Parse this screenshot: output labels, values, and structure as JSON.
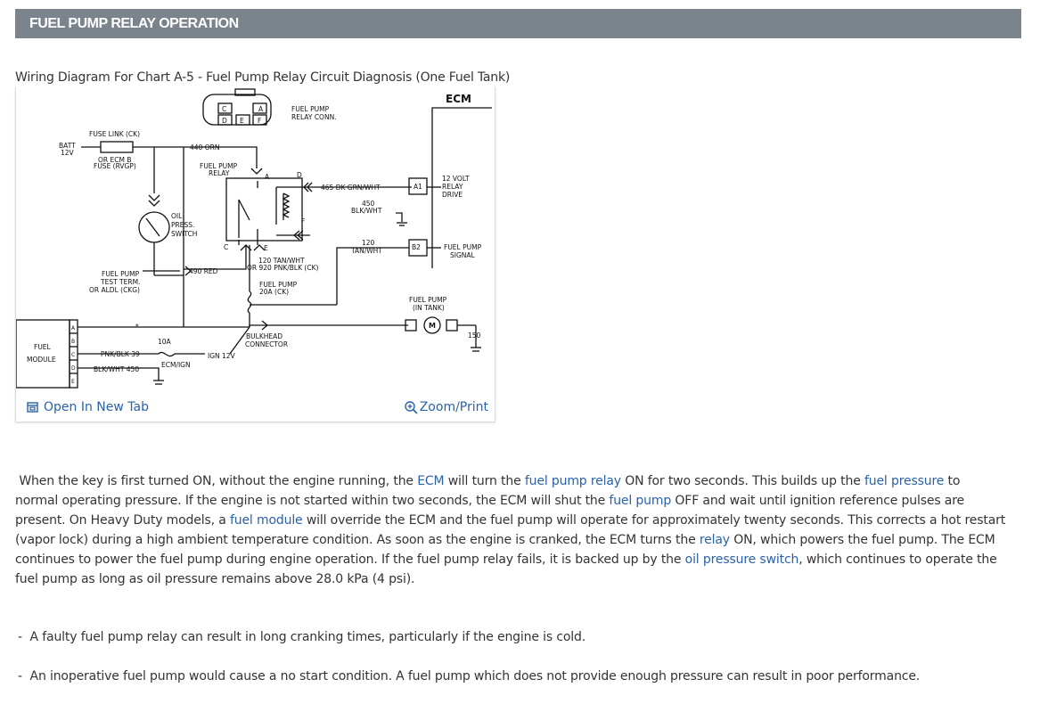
{
  "header": {
    "title": "FUEL PUMP RELAY OPERATION"
  },
  "figure": {
    "caption": "Wiring Diagram For Chart A-5 - Fuel Pump Relay Circuit Diagnosis (One Fuel Tank)",
    "labels": {
      "ecm": "ECM",
      "conn_c": "C",
      "conn_a": "A",
      "conn_d": "D",
      "conn_e": "E",
      "conn_f": "F",
      "relay_conn_1": "FUEL PUMP",
      "relay_conn_2": "RELAY CONN.",
      "fuse_link": "FUSE LINK (CK)",
      "batt": "BATT",
      "batt_v": "12V",
      "or_ecm_b": "OR ECM B",
      "fuse_rvgp": "FUSE (RVGP)",
      "orn_440": "440 ORN",
      "relay_1": "FUEL PUMP",
      "relay_2": "RELAY",
      "pin_a": "A",
      "pin_d": "D",
      "pin_f": "F",
      "pin_c": "C",
      "pin_e": "E",
      "grn_wht": "465 DK GRN/WHT",
      "pin_a1": "A1",
      "drive_1": "12 VOLT",
      "drive_2": "RELAY",
      "drive_3": "DRIVE",
      "blk_450": "450",
      "blk_wht": "BLK/WHT",
      "oil_1": "OIL",
      "oil_2": "PRESS.",
      "oil_3": "SWITCH",
      "tan_120": "120",
      "tan_wht": "TAN/WHT",
      "pin_b2": "B2",
      "signal_1": "FUEL PUMP",
      "signal_2": "SIGNAL",
      "test_1": "FUEL PUMP",
      "test_2": "TEST TERM.",
      "test_3": "OR ALDL (CKG)",
      "red_490": "490 RED",
      "tan_920_1": "120 TAN/WHT",
      "tan_920_2": "OR 920 PNK/BLK (CK)",
      "fuse_20a_1": "FUEL PUMP",
      "fuse_20a_2": "20A (CK)",
      "pump_1": "FUEL PUMP",
      "pump_2": "(IN TANK)",
      "motor_m": "M",
      "v150": "150",
      "star": "*",
      "bulkhead_1": "BULKHEAD",
      "bulkhead_2": "CONNECTOR",
      "fuel_module_1": "FUEL",
      "fuel_module_2": "MODULE",
      "mod_a": "A",
      "mod_b": "B",
      "mod_c": "C",
      "mod_d": "D",
      "mod_e": "E",
      "fuse_10a": "10A",
      "pnk_blk": "PNK/BLK 39",
      "ign_12v": "IGN 12V",
      "ecm_ign": "ECM/IGN",
      "blk_wht_450": "BLK/WHT 450"
    },
    "open_tab_label": "Open In New Tab",
    "zoom_label": "Zoom/Print"
  },
  "description": {
    "p1_a": "When the key is first turned ON, without the engine running, the ",
    "link_ecm": "ECM",
    "p1_b": " will turn the ",
    "link_fuel_pump_relay": "fuel pump relay",
    "p1_c": " ON for two seconds. This builds up the ",
    "link_fuel_pressure": "fuel pressure",
    "p1_d": " to normal operating pressure. If the engine is not started within two seconds, the ECM will shut the ",
    "link_fuel_pump": "fuel pump",
    "p1_e": " OFF and wait until ignition reference pulses are present. On Heavy Duty models, a ",
    "link_fuel_module": "fuel module",
    "p1_f": " will override the ECM and the fuel pump will operate for approximately twenty seconds. This corrects a hot restart (vapor lock) during a high ambient temperature condition. As soon as the engine is cranked, the ECM turns the ",
    "link_relay": "relay",
    "p1_g": " ON, which powers the fuel pump. The ECM continues to power the fuel pump during engine operation. If the fuel pump relay fails, it is backed up by the ",
    "link_oil_pressure_switch": "oil pressure switch",
    "p1_h": ", which continues to operate the fuel pump as long as oil pressure remains above 28.0 kPa (4 psi)."
  },
  "bullets": [
    "A faulty fuel pump relay can result in long cranking times, particularly if the engine is cold.",
    "An inoperative fuel pump would cause a no start condition. A fuel pump which does not provide enough pressure can result in poor performance."
  ],
  "bullet_marker": "-",
  "colors": {
    "header_bg": "#7b848c",
    "link": "#2a62a7",
    "text": "#333333"
  }
}
